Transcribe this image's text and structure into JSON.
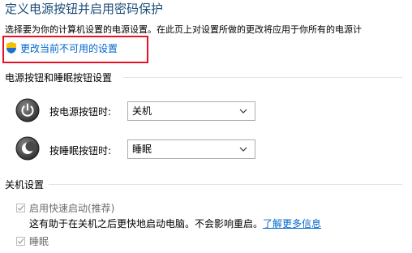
{
  "page": {
    "title": "定义电源按钮并启用密码保护",
    "description": "选择要为你的计算机设置的电源设置。在此页上对设置所做的更改将应用于你所有的电源计",
    "change_link": "更改当前不可用的设置"
  },
  "power_section": {
    "title": "电源按钮和睡眠按钮设置",
    "power_button": {
      "label": "按电源按钮时:",
      "value": "关机"
    },
    "sleep_button": {
      "label": "按睡眠按钮时:",
      "value": "睡眠"
    }
  },
  "shutdown_section": {
    "title": "关机设置",
    "fast_startup": {
      "label": "启用快速启动(推荐)",
      "checked": true,
      "hint": "这有助于在关机之后更快地启动电脑。不会影响重启。",
      "hint_link": "了解更多信息"
    },
    "sleep": {
      "label": "睡眠",
      "checked": true
    }
  },
  "colors": {
    "title": "#1e4e79",
    "link": "#0066cc",
    "highlight": "#e81123"
  },
  "icons": {
    "shield": "uac-shield-icon",
    "power": "power-icon",
    "sleep": "moon-icon",
    "chevron": "chevron-down-icon"
  }
}
